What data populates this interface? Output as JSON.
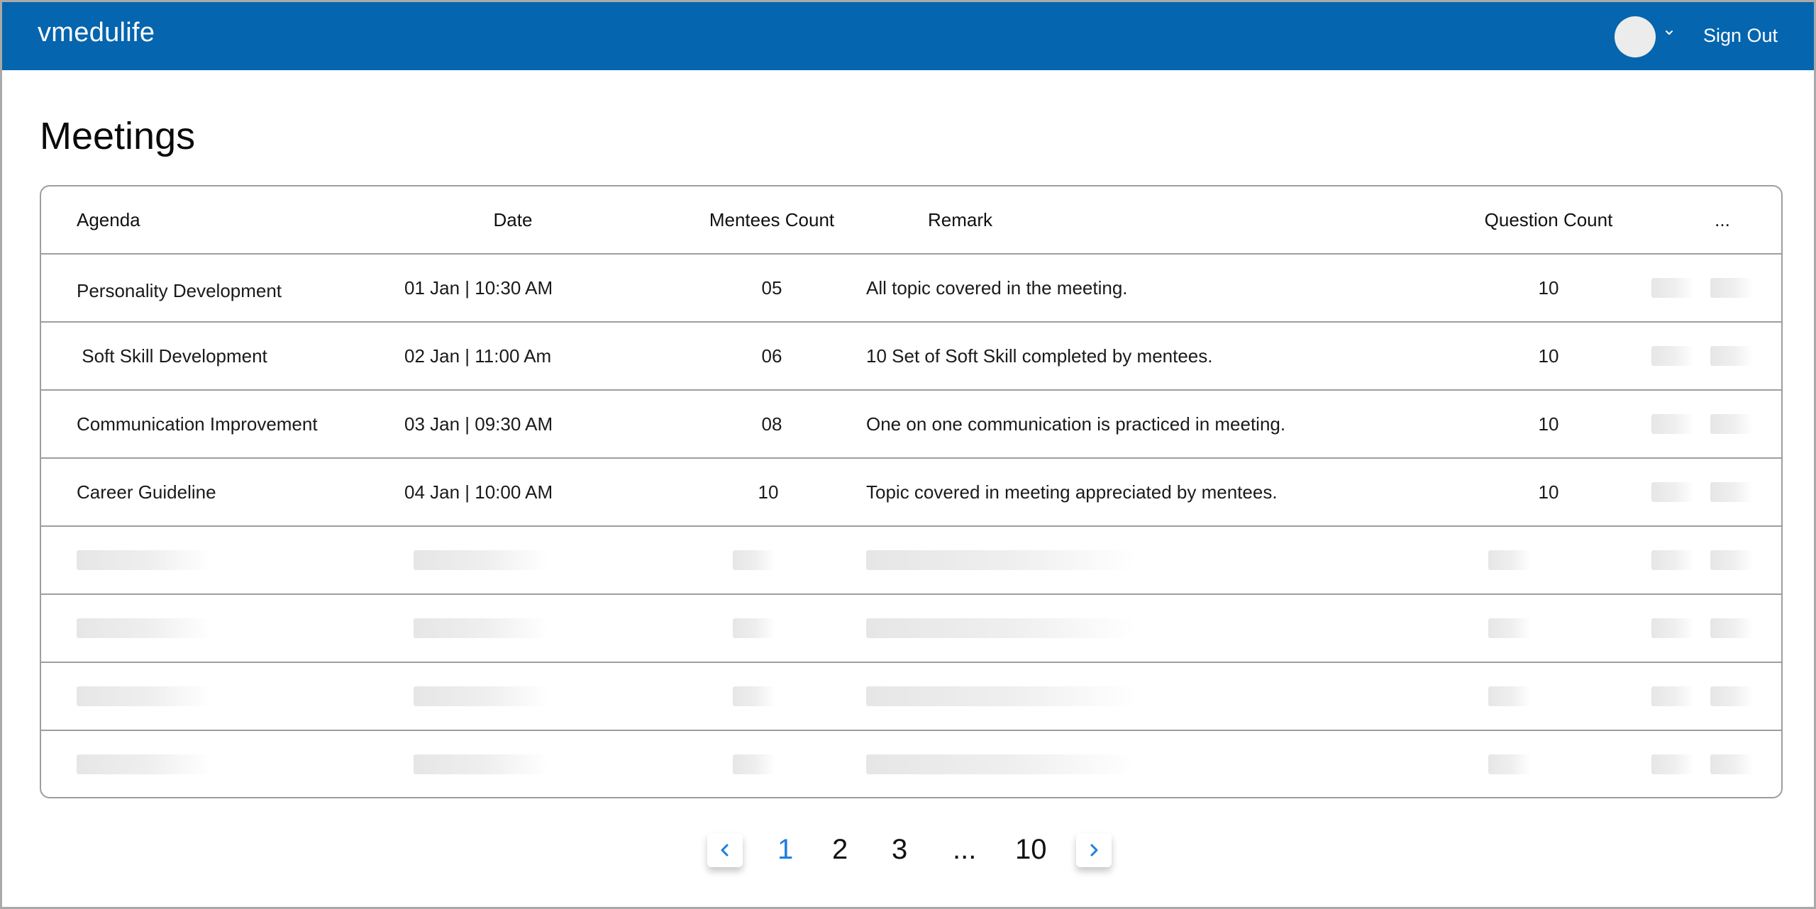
{
  "topbar": {
    "brand": "vmedulife",
    "signout_label": "Sign Out",
    "avatar_icon": "avatar",
    "caret_icon": "chevron-down-icon"
  },
  "page": {
    "title": "Meetings"
  },
  "table": {
    "columns": [
      "Agenda",
      "Date",
      "Mentees Count",
      "Remark",
      "Question Count",
      "..."
    ],
    "rows": [
      {
        "agenda": "Personality Development",
        "date": "01 Jan | 10:30 AM",
        "mentees": "05",
        "remark": "All topic covered in the meeting.",
        "questions": "10"
      },
      {
        "agenda": " Soft Skill Development",
        "date": "02 Jan | 11:00 Am",
        "mentees": "06",
        "remark": "10 Set of Soft Skill completed by mentees.",
        "questions": "10"
      },
      {
        "agenda": "Communication Improvement",
        "date": "03 Jan | 09:30 AM",
        "mentees": "08",
        "remark": "One on one communication is practiced in meeting.",
        "questions": "10"
      },
      {
        "agenda": "Career Guideline",
        "date": "04 Jan | 10:00 AM",
        "mentees": "10",
        "remark": "Topic covered in meeting appreciated by mentees.",
        "questions": "10"
      }
    ]
  },
  "pagination": {
    "prev_icon": "chevron-left-icon",
    "next_icon": "chevron-right-icon",
    "pages": [
      "1",
      "2",
      "3",
      "...",
      "10"
    ],
    "active_page": "1"
  },
  "colors": {
    "topbar": "#0565ae",
    "accent": "#1f7de0",
    "border": "#9e9e9e"
  }
}
